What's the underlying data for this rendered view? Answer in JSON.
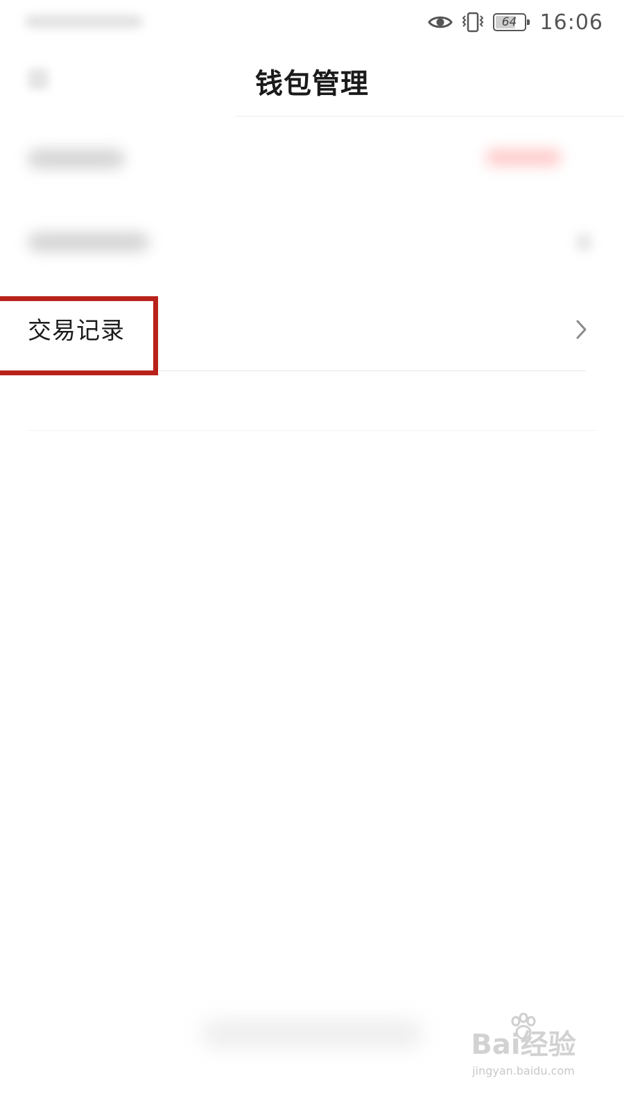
{
  "status_bar": {
    "battery_level": "64",
    "time": "16:06",
    "icons": [
      "eye-icon",
      "vibrate-icon",
      "battery-icon"
    ]
  },
  "header": {
    "title": "钱包管理"
  },
  "list": {
    "highlighted_item_label": "交易记录",
    "highlight_color": "#b8221b"
  },
  "watermark": {
    "brand": "Bai经验",
    "url": "jingyan.baidu.com"
  }
}
